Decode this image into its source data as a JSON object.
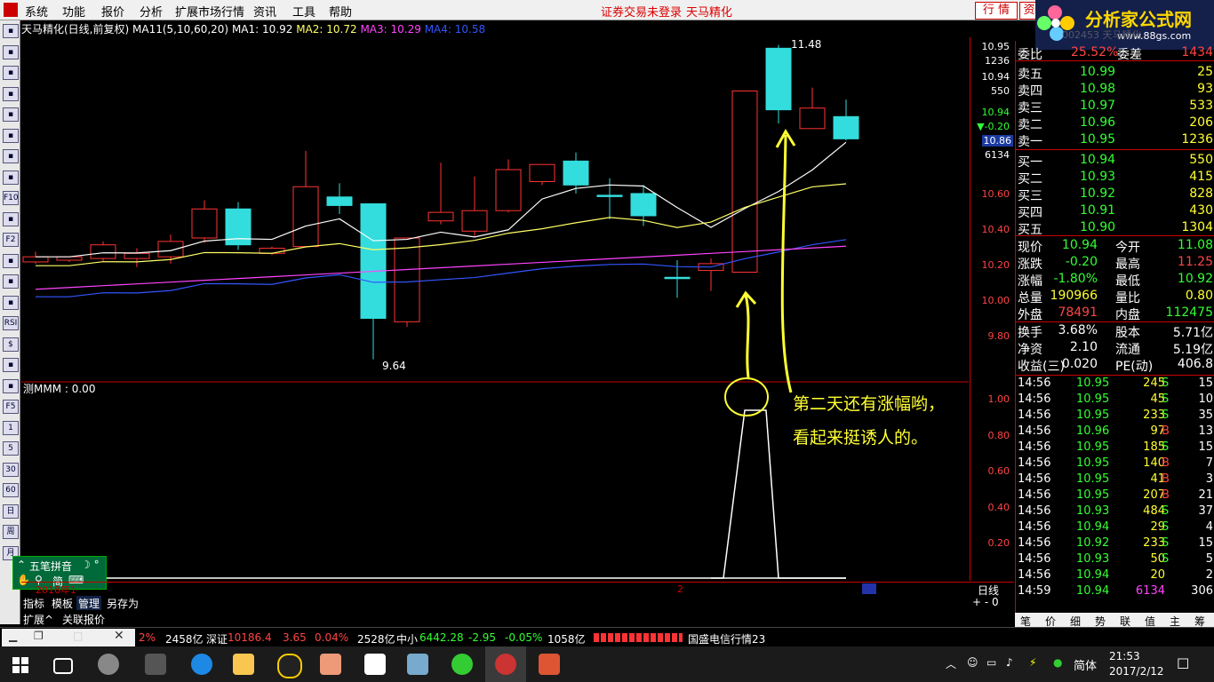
{
  "menu": [
    "系统",
    "功能",
    "报价",
    "分析",
    "扩展市场行情",
    "资讯",
    "工具",
    "帮助"
  ],
  "status_msg": "证券交易未登录",
  "stock_title": "天马精化",
  "hq_buttons": [
    "行 情",
    "资"
  ],
  "brand": {
    "name": "分析家公式网",
    "url": "www.88gs.com",
    "faded_code": "002453 天马精化"
  },
  "toolbar_icons": [
    "back-icon",
    "up-icon",
    "down-icon",
    "chart-icon",
    "table-icon",
    "trend-icon",
    "kline-icon",
    "layers-icon",
    "f10-icon",
    "box-icon",
    "f2-icon",
    "circle-icon",
    "grid-icon",
    "wave-icon",
    "rsi-icon",
    "dollar-icon",
    "move-icon",
    "pen-icon",
    "f5-icon",
    "1",
    "5",
    "30",
    "60",
    "日",
    "周",
    "月"
  ],
  "info": {
    "title": "天马精化(日线,前复权)",
    "ma_params": "MA11(5,10,60,20)",
    "ma1": "MA1: 10.92",
    "ma2": "MA2: 10.72",
    "ma3": "MA3: 10.29",
    "ma4": "MA4: 10.58",
    "colors": {
      "ma1": "#ffffff",
      "ma2": "#ffff66",
      "ma3": "#ff44ff",
      "ma4": "#3355ff",
      "up": "#ff3333",
      "down": "#33dddd"
    }
  },
  "price_axis": [
    {
      "v": "10.95",
      "c": "#ffffff"
    },
    {
      "v": "1236",
      "c": "#ffffff"
    },
    {
      "v": "10.94",
      "c": "#ffffff"
    },
    {
      "v": "550",
      "c": "#ffffff"
    },
    {
      "v": "10.94",
      "c": "#33ff33"
    },
    {
      "v": "▼-0.20",
      "c": "#33ff33"
    },
    {
      "v": "10.86",
      "c": "#ffffff"
    },
    {
      "v": "6134",
      "c": "#ffffff"
    },
    {
      "v": "10.60",
      "c": "#ff4444"
    },
    {
      "v": "10.40",
      "c": "#ff4444"
    },
    {
      "v": "10.20",
      "c": "#ff4444"
    },
    {
      "v": "10.00",
      "c": "#ff4444"
    },
    {
      "v": "9.80",
      "c": "#ff4444"
    }
  ],
  "lower_axis": [
    "1.00",
    "0.80",
    "0.60",
    "0.40",
    "0.20"
  ],
  "indicator_label": "测MMM : 0.00",
  "chart_high_label": "11.48",
  "chart_low_label": "9.64",
  "chart_data": {
    "type": "candlestick",
    "candles": [
      {
        "o": 10.21,
        "c": 10.24,
        "h": 10.27,
        "l": 10.2
      },
      {
        "o": 10.22,
        "c": 10.24,
        "h": 10.24,
        "l": 10.21
      },
      {
        "o": 10.23,
        "c": 10.31,
        "h": 10.33,
        "l": 10.21
      },
      {
        "o": 10.23,
        "c": 10.26,
        "h": 10.29,
        "l": 10.18
      },
      {
        "o": 10.24,
        "c": 10.33,
        "h": 10.37,
        "l": 10.2
      },
      {
        "o": 10.35,
        "c": 10.52,
        "h": 10.57,
        "l": 10.32
      },
      {
        "o": 10.52,
        "c": 10.31,
        "h": 10.56,
        "l": 10.28
      },
      {
        "o": 10.26,
        "c": 10.29,
        "h": 10.3,
        "l": 10.25
      },
      {
        "o": 10.3,
        "c": 10.65,
        "h": 10.86,
        "l": 10.3
      },
      {
        "o": 10.59,
        "c": 10.54,
        "h": 10.67,
        "l": 10.49
      },
      {
        "o": 10.55,
        "c": 9.88,
        "h": 10.55,
        "l": 9.64
      },
      {
        "o": 9.86,
        "c": 10.35,
        "h": 10.35,
        "l": 9.83
      },
      {
        "o": 10.45,
        "c": 10.5,
        "h": 10.79,
        "l": 10.43
      },
      {
        "o": 10.39,
        "c": 10.51,
        "h": 10.71,
        "l": 10.36
      },
      {
        "o": 10.51,
        "c": 10.75,
        "h": 10.81,
        "l": 10.5
      },
      {
        "o": 10.68,
        "c": 10.78,
        "h": 10.76,
        "l": 10.66
      },
      {
        "o": 10.8,
        "c": 10.66,
        "h": 10.85,
        "l": 10.61
      },
      {
        "o": 10.6,
        "c": 10.6,
        "h": 10.7,
        "l": 10.46
      },
      {
        "o": 10.61,
        "c": 10.48,
        "h": 10.66,
        "l": 10.42
      },
      {
        "o": 10.12,
        "c": 10.12,
        "h": 10.22,
        "l": 10.0
      },
      {
        "o": 10.16,
        "c": 10.2,
        "h": 10.23,
        "l": 10.04
      },
      {
        "o": 10.15,
        "c": 11.21,
        "h": 11.21,
        "l": 10.15
      },
      {
        "o": 11.46,
        "c": 11.1,
        "h": 11.48,
        "l": 11.02
      },
      {
        "o": 10.99,
        "c": 11.11,
        "h": 11.23,
        "l": 10.99
      },
      {
        "o": 11.06,
        "c": 10.93,
        "h": 11.16,
        "l": 10.92
      }
    ],
    "ylim": [
      9.55,
      11.55
    ]
  },
  "quote": {
    "ratio": {
      "label": "委比",
      "value": "25.52%",
      "label2": "委差",
      "value2": "1434"
    },
    "asks": [
      {
        "label": "卖五",
        "price": "10.99",
        "vol": "25"
      },
      {
        "label": "卖四",
        "price": "10.98",
        "vol": "93"
      },
      {
        "label": "卖三",
        "price": "10.97",
        "vol": "533"
      },
      {
        "label": "卖二",
        "price": "10.96",
        "vol": "206"
      },
      {
        "label": "卖一",
        "price": "10.95",
        "vol": "1236"
      }
    ],
    "bids": [
      {
        "label": "买一",
        "price": "10.94",
        "vol": "550"
      },
      {
        "label": "买二",
        "price": "10.93",
        "vol": "415"
      },
      {
        "label": "买三",
        "price": "10.92",
        "vol": "828"
      },
      {
        "label": "买四",
        "price": "10.91",
        "vol": "430"
      },
      {
        "label": "买五",
        "price": "10.90",
        "vol": "1304"
      }
    ],
    "stats": [
      {
        "l1": "现价",
        "v1": "10.94",
        "c1": "#33ff33",
        "l2": "今开",
        "v2": "11.08",
        "c2": "#33ff33"
      },
      {
        "l1": "涨跌",
        "v1": "-0.20",
        "c1": "#33ff33",
        "l2": "最高",
        "v2": "11.25",
        "c2": "#ff4444"
      },
      {
        "l1": "涨幅",
        "v1": "-1.80%",
        "c1": "#33ff33",
        "l2": "最低",
        "v2": "10.92",
        "c2": "#33ff33"
      },
      {
        "l1": "总量",
        "v1": "190966",
        "c1": "#ffff33",
        "l2": "量比",
        "v2": "0.80",
        "c2": "#ffff33"
      },
      {
        "l1": "外盘",
        "v1": "78491",
        "c1": "#ff4444",
        "l2": "内盘",
        "v2": "112475",
        "c2": "#33ff33"
      }
    ],
    "stats2": [
      {
        "l1": "换手",
        "v1": "3.68%",
        "l2": "股本",
        "v2": "5.71亿"
      },
      {
        "l1": "净资",
        "v1": "2.10",
        "l2": "流通",
        "v2": "5.19亿"
      },
      {
        "l1": "收益(三)",
        "v1": "0.020",
        "l2": "PE(动)",
        "v2": "406.8"
      }
    ]
  },
  "ticks": [
    {
      "t": "14:56",
      "p": "10.95",
      "v": "245",
      "s": "S",
      "n": "15"
    },
    {
      "t": "14:56",
      "p": "10.95",
      "v": "45",
      "s": "S",
      "n": "10"
    },
    {
      "t": "14:56",
      "p": "10.95",
      "v": "233",
      "s": "S",
      "n": "35"
    },
    {
      "t": "14:56",
      "p": "10.96",
      "v": "97",
      "s": "B",
      "n": "13"
    },
    {
      "t": "14:56",
      "p": "10.95",
      "v": "185",
      "s": "S",
      "n": "15"
    },
    {
      "t": "14:56",
      "p": "10.95",
      "v": "140",
      "s": "B",
      "n": "7"
    },
    {
      "t": "14:56",
      "p": "10.95",
      "v": "41",
      "s": "B",
      "n": "3"
    },
    {
      "t": "14:56",
      "p": "10.95",
      "v": "207",
      "s": "B",
      "n": "21"
    },
    {
      "t": "14:56",
      "p": "10.93",
      "v": "484",
      "s": "S",
      "n": "37"
    },
    {
      "t": "14:56",
      "p": "10.94",
      "v": "29",
      "s": "S",
      "n": "4"
    },
    {
      "t": "14:56",
      "p": "10.92",
      "v": "233",
      "s": "S",
      "n": "15"
    },
    {
      "t": "14:56",
      "p": "10.93",
      "v": "50",
      "s": "S",
      "n": "5"
    },
    {
      "t": "14:56",
      "p": "10.94",
      "v": "20",
      "s": "",
      "n": "2"
    },
    {
      "t": "14:59",
      "p": "10.94",
      "v": "6134",
      "s": "",
      "n": "306"
    }
  ],
  "annotation": {
    "line1": "第二天还有涨幅哟，",
    "line2": "看起来挺诱人的。"
  },
  "bottom_tabs": [
    "指标",
    "模板",
    "管理",
    "另存为"
  ],
  "bottom_tabs2": [
    "扩展^",
    "关联报价"
  ],
  "period_label": "日线",
  "date_label": "2016年1",
  "right_tabs": [
    "笔",
    "价",
    "细",
    "势",
    "联",
    "值",
    "主",
    "筹"
  ],
  "ime": {
    "title": "五笔拼音",
    "mode": "简"
  },
  "status": [
    {
      "t": "2%",
      "c": "#ff4444"
    },
    {
      "t": "2458亿",
      "c": "#ffffff"
    },
    {
      "t": "深证",
      "c": "#ffffff"
    },
    {
      "t": "10186.4",
      "c": "#ff4444"
    },
    {
      "t": "3.65",
      "c": "#ff4444"
    },
    {
      "t": "0.04%",
      "c": "#ff4444"
    },
    {
      "t": "2528亿",
      "c": "#ffffff"
    },
    {
      "t": "中小",
      "c": "#ffffff"
    },
    {
      "t": "6442.28",
      "c": "#33ff33"
    },
    {
      "t": "-2.95",
      "c": "#33ff33"
    },
    {
      "t": "-0.05%",
      "c": "#33ff33"
    },
    {
      "t": "1058亿",
      "c": "#ffffff"
    },
    {
      "t": "国盛电信行情23",
      "c": "#ffffff"
    }
  ],
  "taskbar": {
    "time": "21:53",
    "date": "2017/2/12",
    "lang": "简体"
  }
}
